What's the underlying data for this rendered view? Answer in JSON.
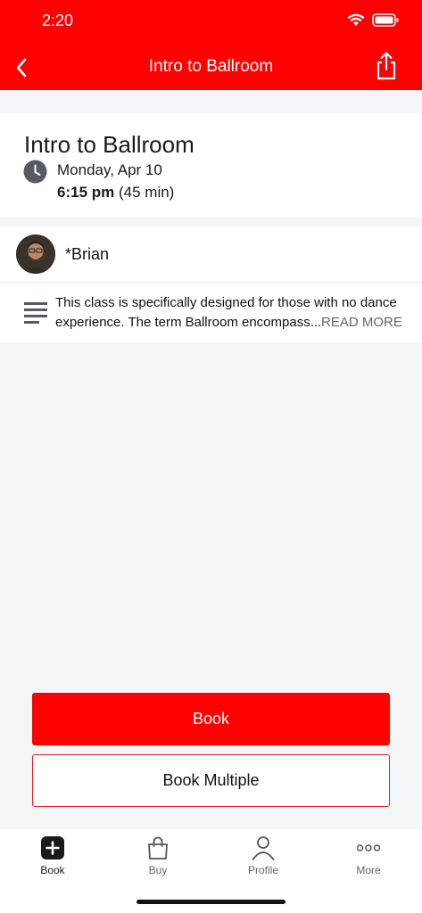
{
  "status_bar": {
    "time": "2:20"
  },
  "nav": {
    "title": "Intro to Ballroom"
  },
  "class_info": {
    "title": "Intro to Ballroom",
    "date": "Monday, Apr 10",
    "time": "6:15 pm",
    "duration": "(45 min)"
  },
  "instructor": {
    "name": "*Brian"
  },
  "description": {
    "text": "This class is specifically designed for those with no dance experience. The term Ballroom encompass...",
    "read_more": "READ MORE"
  },
  "actions": {
    "book_label": "Book",
    "book_multiple_label": "Book Multiple"
  },
  "tabbar": {
    "items": [
      {
        "label": "Book",
        "icon": "plus-square-icon"
      },
      {
        "label": "Buy",
        "icon": "shopping-bag-icon"
      },
      {
        "label": "Profile",
        "icon": "person-icon"
      },
      {
        "label": "More",
        "icon": "more-dots-icon"
      }
    ]
  },
  "colors": {
    "accent": "#fe0000",
    "background": "#f4f5f7"
  }
}
